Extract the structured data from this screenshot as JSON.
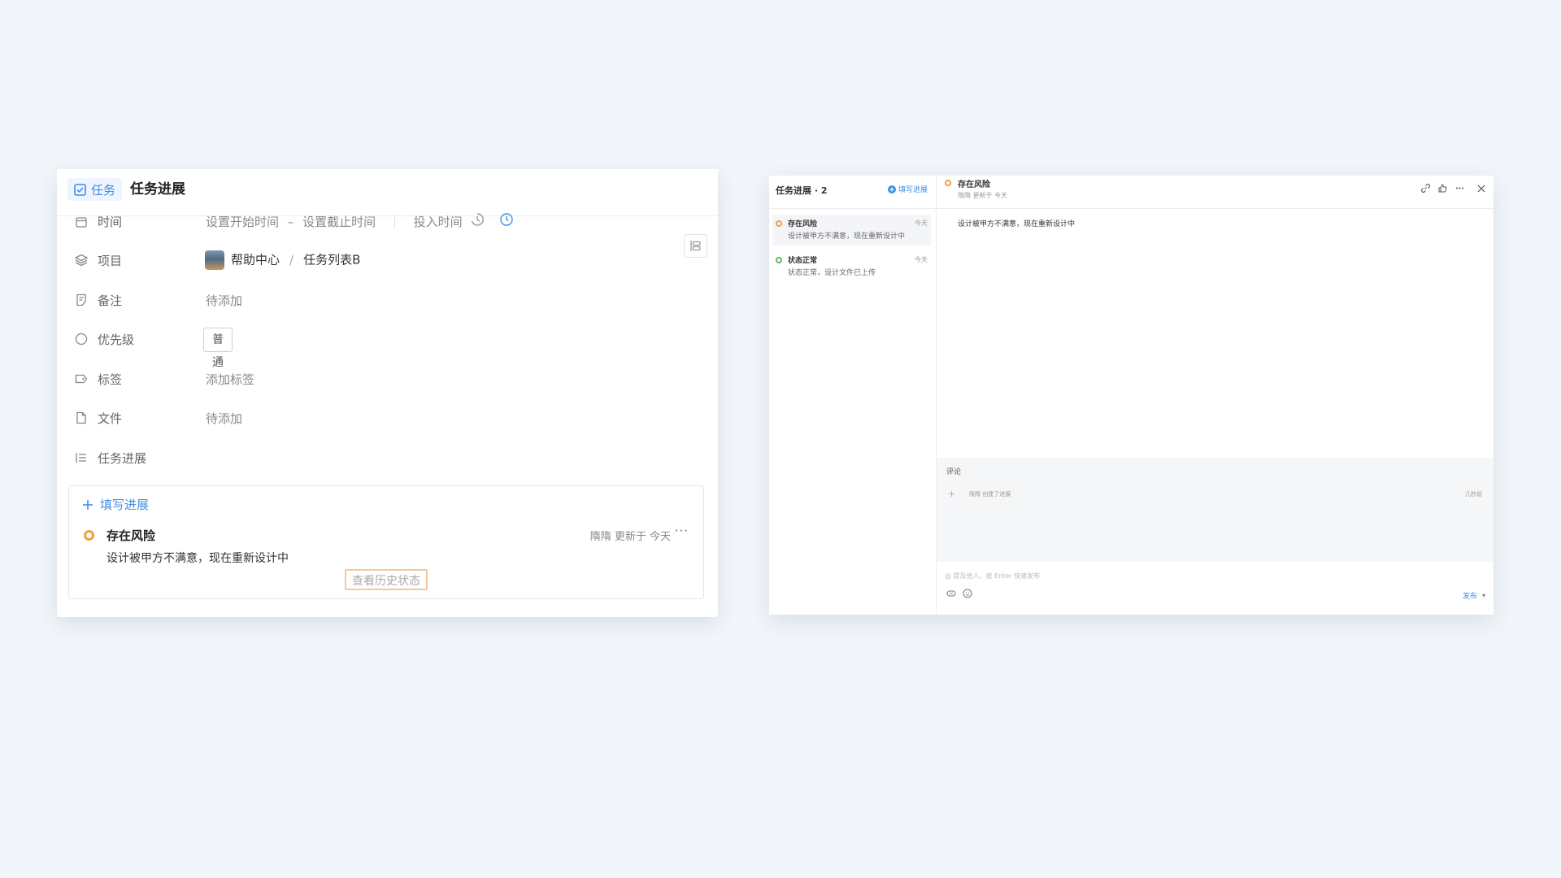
{
  "left_panel": {
    "chip_label": "任务",
    "title": "任务进展",
    "fields": {
      "time": {
        "label": "时间",
        "start_placeholder": "设置开始时间",
        "dash": "–",
        "end_placeholder": "设置截止时间",
        "invest_time": "投入时间"
      },
      "project": {
        "label": "项目",
        "name": "帮助中心",
        "separator": "/",
        "list": "任务列表B"
      },
      "note": {
        "label": "备注",
        "value": "待添加"
      },
      "priority": {
        "label": "优先级",
        "value": "普通"
      },
      "tags": {
        "label": "标签",
        "value": "添加标签"
      },
      "files": {
        "label": "文件",
        "value": "待添加"
      },
      "progress": {
        "label": "任务进展"
      }
    },
    "progress_card": {
      "add_label": "填写进展",
      "status": "存在风险",
      "status_color": "#f0a040",
      "meta": "隋隋 更新于 今天",
      "more": "···",
      "description": "设计被甲方不满意，现在重新设计中",
      "history_button": "查看历史状态"
    }
  },
  "right_panel": {
    "list_title": "任务进展 · 2",
    "fill_progress": "填写进展",
    "items": [
      {
        "status": "存在风险",
        "time": "今天",
        "desc": "设计被甲方不满意，现在重新设计中",
        "color": "#f0a040"
      },
      {
        "status": "状态正常",
        "time": "今天",
        "desc": "状态正常，设计文件已上传",
        "color": "#5cb85c"
      }
    ],
    "detail": {
      "status": "存在风险",
      "meta": "隋隋 更新于 今天",
      "body": "设计被甲方不满意，现在重新设计中"
    },
    "comments": {
      "title": "评论",
      "activity": "隋隋 创建了进展",
      "activity_time": "几秒前"
    },
    "composer": {
      "placeholder": "@ 提及他人，按 Enter 快速发布",
      "publish": "发布",
      "publish_caret": "▾"
    }
  }
}
